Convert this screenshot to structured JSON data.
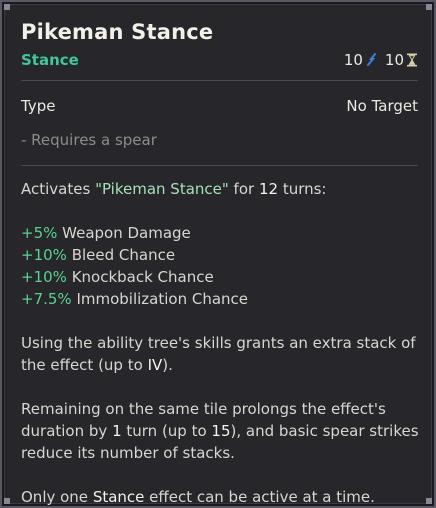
{
  "title": "Pikeman Stance",
  "category": "Stance",
  "costs": {
    "energy": "10",
    "cooldown": "10",
    "energy_icon": "energy-icon",
    "cooldown_icon": "hourglass-icon"
  },
  "type": {
    "label": "Type",
    "value": "No Target"
  },
  "requirement": "- Requires a spear",
  "activation": {
    "prefix": "Activates ",
    "effect_name": "\"Pikeman Stance\"",
    "middle": " for ",
    "turns": "12",
    "suffix": " turns:"
  },
  "stats": [
    {
      "value": "+5%",
      "label": " Weapon Damage"
    },
    {
      "value": "+10%",
      "label": " Bleed Chance"
    },
    {
      "value": "+10%",
      "label": " Knockback Chance"
    },
    {
      "value": "+7.5%",
      "label": " Immobilization Chance"
    }
  ],
  "stacking": {
    "part1": "Using the ability tree's skills grants an extra stack of the effect (up to ",
    "max": "IV",
    "part2": ")."
  },
  "tile": {
    "part1": "Remaining on the same tile prolongs the effect's duration by ",
    "turns": "1",
    "part2": " turn (up to ",
    "max": "15",
    "part3": "), and basic spear strikes reduce its number of stacks."
  },
  "exclusivity": {
    "part1": "Only one ",
    "keyword": "Stance",
    "part2": " effect can be active at a time."
  },
  "colors": {
    "category": "#3fc79a",
    "positive": "#58d38f",
    "energy": "#3b7fe0",
    "hourglass": "#d8cfa8"
  }
}
